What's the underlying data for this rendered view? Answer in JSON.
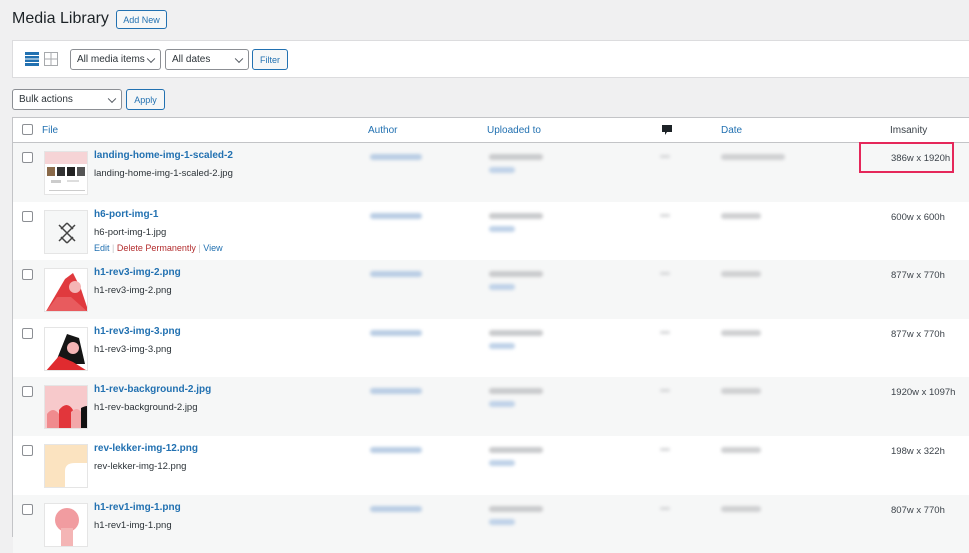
{
  "page": {
    "title": "Media Library",
    "add_new": "Add New"
  },
  "filters": {
    "media_type": "All media items",
    "dates": "All dates",
    "filter_button": "Filter",
    "view_modes": [
      "list-view-icon",
      "grid-view-icon"
    ],
    "active_view": "list"
  },
  "bulk": {
    "action": "Bulk actions",
    "apply": "Apply"
  },
  "table": {
    "columns": {
      "file": "File",
      "author": "Author",
      "uploaded_to": "Uploaded to",
      "comments": "comment-icon",
      "date": "Date",
      "imsanity": "Imsanity"
    },
    "rows": [
      {
        "title": "landing-home-img-1-scaled-2",
        "filename": "landing-home-img-1-scaled-2.jpg",
        "dimensions": "386w x 1920h",
        "thumb": "website"
      },
      {
        "title": "h6-port-img-1",
        "filename": "h6-port-img-1.jpg",
        "dimensions": "600w x 600h",
        "thumb": "arrows",
        "actions": [
          "Edit",
          "Delete Permanently",
          "View"
        ]
      },
      {
        "title": "h1-rev3-img-2.png",
        "filename": "h1-rev3-img-2.png",
        "dimensions": "877w x 770h",
        "thumb": "red-woman"
      },
      {
        "title": "h1-rev3-img-3.png",
        "filename": "h1-rev3-img-3.png",
        "dimensions": "877w x 770h",
        "thumb": "black-hair-woman"
      },
      {
        "title": "h1-rev-background-2.jpg",
        "filename": "h1-rev-background-2.jpg",
        "dimensions": "1920w x 1097h",
        "thumb": "pink-women"
      },
      {
        "title": "rev-lekker-img-12.png",
        "filename": "rev-lekker-img-12.png",
        "dimensions": "198w x 322h",
        "thumb": "beige-arch"
      },
      {
        "title": "h1-rev1-img-1.png",
        "filename": "h1-rev1-img-1.png",
        "dimensions": "807w x 770h",
        "thumb": "pink-face"
      }
    ]
  },
  "colors": {
    "accent": "#2271b1",
    "delete": "#b32d2e",
    "highlight": "#e5275a"
  }
}
